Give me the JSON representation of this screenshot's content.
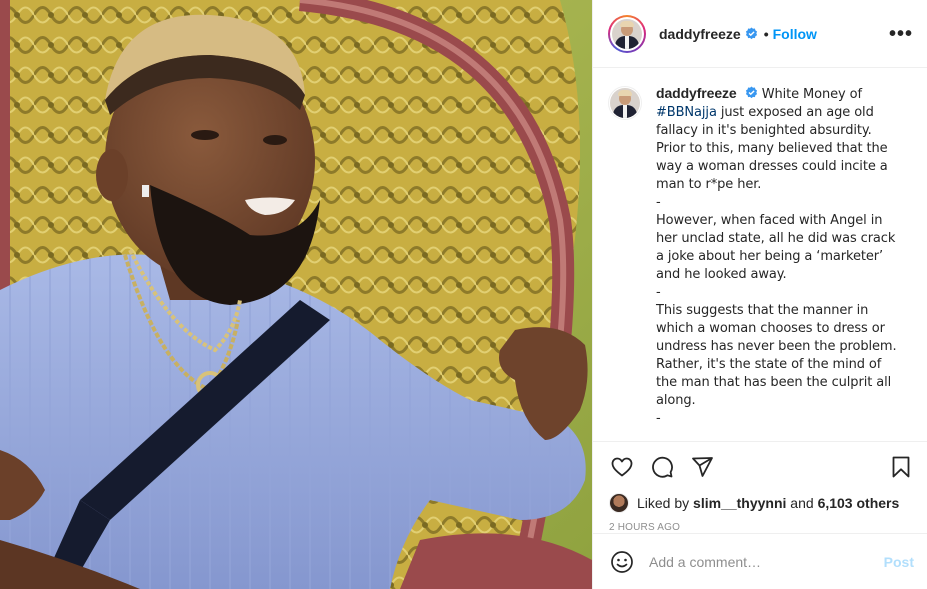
{
  "header": {
    "username": "daddyfreeze",
    "separator": "•",
    "follow_label": "Follow",
    "more_label": "•••"
  },
  "caption": {
    "username": "daddyfreeze",
    "intro": "White Money of",
    "hashtag": "#BBNajja",
    "line1_rest": " just exposed an age old fallacy in it's benighted absurdity. Prior to this, many believed that the way a woman dresses could incite a man to r*pe her.",
    "dash1": "-",
    "para2": "However, when faced with Angel in her unclad state, all he did was crack a joke about her being a ‘marketer’ and he looked away.",
    "dash2": "-",
    "para3": "This suggests that the manner in which a woman chooses to dress or undress has never been the problem. Rather, it's the state of the mind of the man that has been the culprit all along.",
    "dash3": "-"
  },
  "likes": {
    "prefix": "Liked by ",
    "user": "slim__thyynni",
    "middle": " and ",
    "count": "6,103 others"
  },
  "timestamp": "2 HOURS AGO",
  "comment": {
    "placeholder": "Add a comment…",
    "post_label": "Post"
  },
  "icons": {
    "verified": "verified-badge-icon",
    "like": "heart-icon",
    "comment": "comment-bubble-icon",
    "share": "paper-plane-icon",
    "save": "bookmark-icon",
    "emoji": "smiley-icon"
  },
  "colors": {
    "accent": "#0095f6",
    "hashtag": "#00376b",
    "muted": "#8e8e8e",
    "post_disabled": "#b2dffc"
  }
}
